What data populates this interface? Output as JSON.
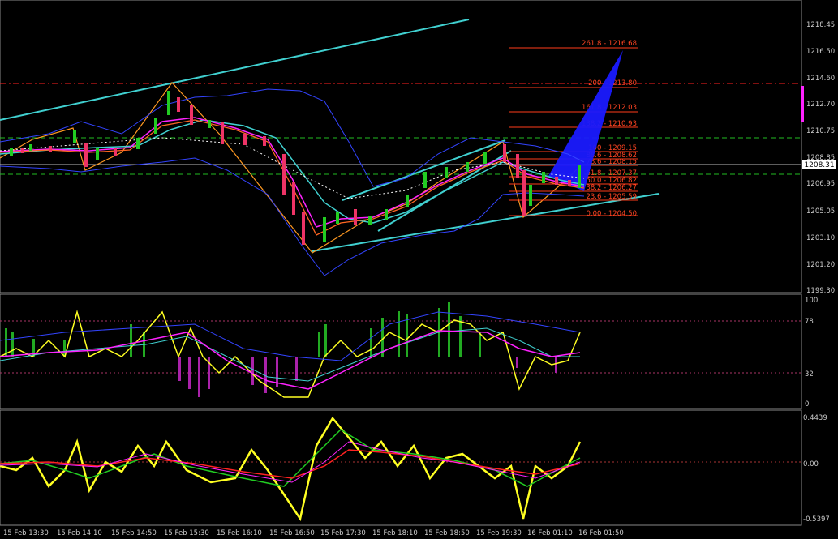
{
  "main": {
    "price_labels": [
      "1218.45",
      "1216.50",
      "1214.60",
      "1212.70",
      "1210.75",
      "1208.85",
      "1206.95",
      "1205.05",
      "1203.10",
      "1201.20",
      "1199.30"
    ],
    "current_price": "1208.31",
    "fibo": [
      "261.8 - 1216.68",
      "200 - 1213.80",
      "161.8 - 1212.03",
      "138.2 - 1210.93",
      "100 - 1209.15",
      "88.6 - 1208.62",
      "78.6 - 1208.15",
      "61.8 - 1207.37",
      "50.0 - 1206.82",
      "38.2 - 1206.27",
      "23.6 - 1205.59",
      "0.00 - 1204.50"
    ]
  },
  "oscillator": {
    "labels": [
      "100",
      "78",
      "32",
      "0"
    ]
  },
  "macd": {
    "labels": [
      "0.4439",
      "0.00",
      "-0.5397"
    ]
  },
  "time_axis": [
    "15 Feb 13:30",
    "15 Feb 14:10",
    "15 Feb 14:50",
    "15 Feb 15:30",
    "15 Feb 16:10",
    "15 Feb 16:50",
    "15 Feb 17:30",
    "15 Feb 18:10",
    "15 Feb 18:50",
    "15 Feb 19:30",
    "16 Feb 01:10",
    "16 Feb 01:50"
  ],
  "colors": {
    "bull": "#22cc22",
    "bear": "#ee3366",
    "trendline": "#40d0d0",
    "fibo": "#ff3b1a",
    "bollinger": "#3344ff",
    "ma_magenta": "#ff22ff",
    "ma_orange": "#ff6622",
    "signal_yellow": "#ffff22"
  }
}
